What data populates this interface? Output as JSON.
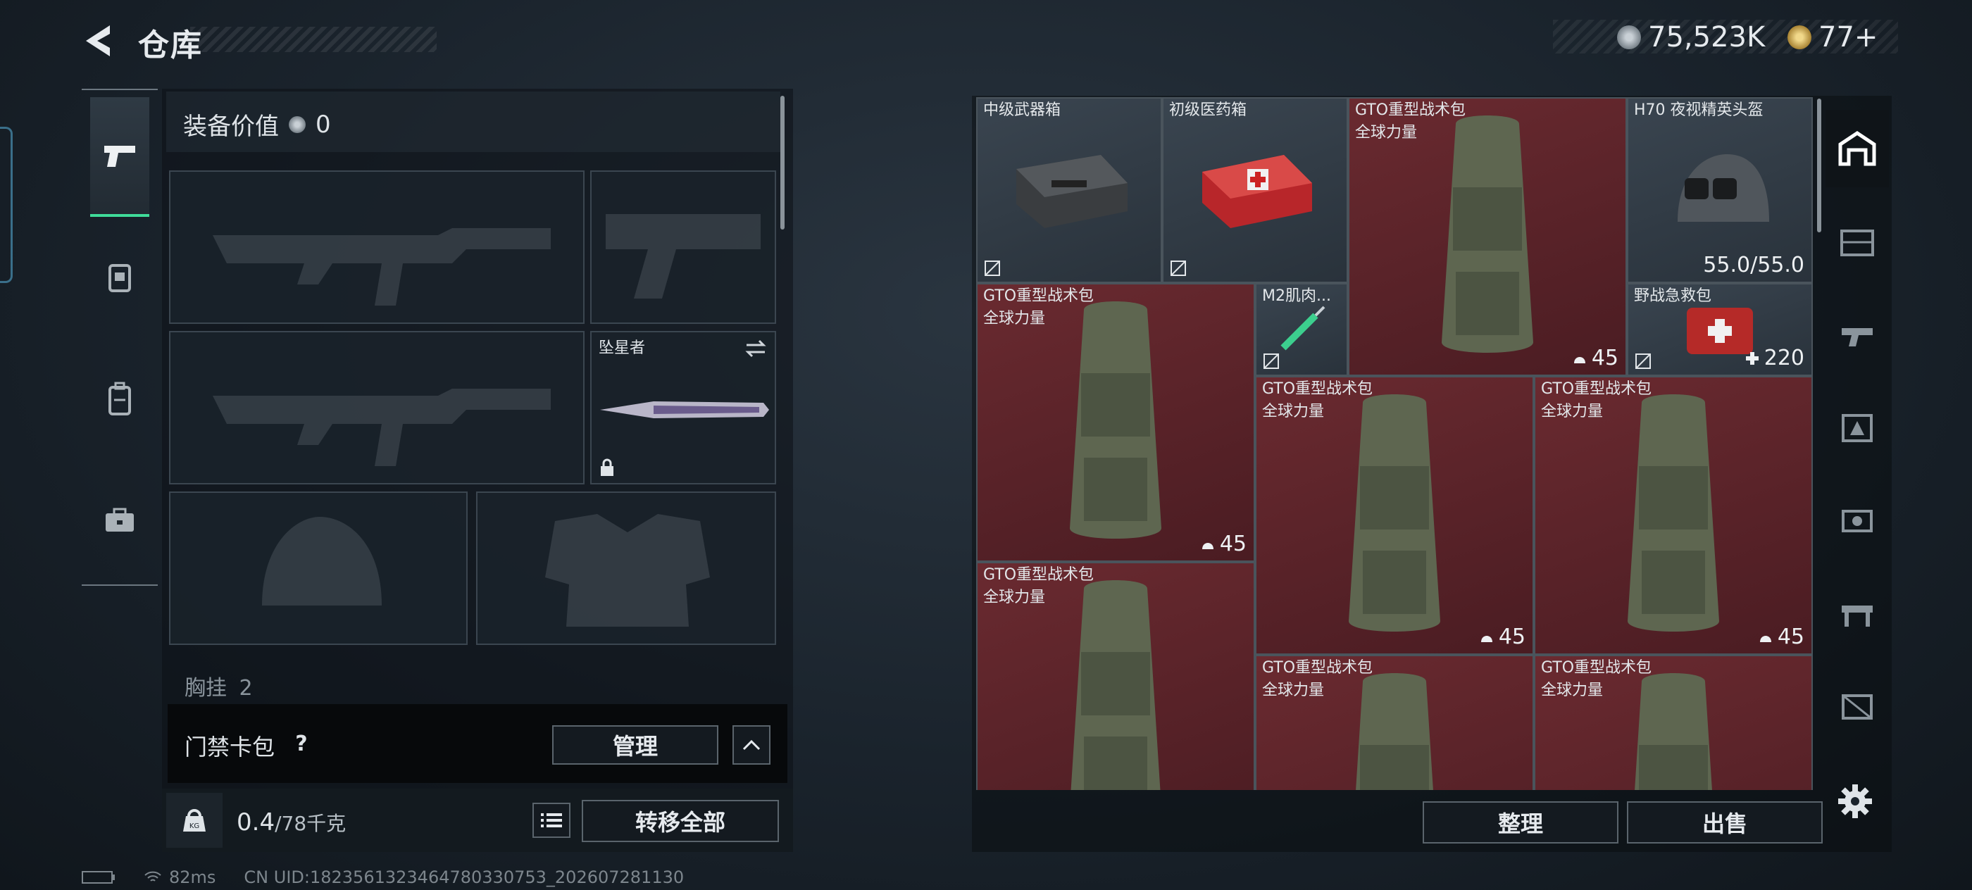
{
  "header": {
    "title": "仓库",
    "currency_1": "75,523K",
    "currency_2": "77+"
  },
  "equipment": {
    "value_label": "装备价值",
    "value": "0",
    "melee_name": "坠星者",
    "chest_label": "胸挂",
    "chest_value": "2",
    "keycard_label": "门禁卡包",
    "manage_label": "管理",
    "weight_current": "0.4",
    "weight_max": "/78千克",
    "transfer_all_label": "转移全部"
  },
  "status": {
    "ping": "82ms",
    "uid": "CN UID:1823561323464780330753_202607281130"
  },
  "storage": {
    "items": [
      {
        "name": "中级武器箱",
        "sub": "",
        "count": "",
        "color": "gray"
      },
      {
        "name": "初级医药箱",
        "sub": "",
        "count": "",
        "color": "gray"
      },
      {
        "name": "GTO重型战术包",
        "sub": "全球力量",
        "count": "45",
        "color": "red"
      },
      {
        "name": "H70 夜视精英头盔",
        "sub": "",
        "count": "55.0/55.0",
        "color": "gray"
      },
      {
        "name": "GTO重型战术包",
        "sub": "全球力量",
        "count": "45",
        "color": "red"
      },
      {
        "name": "M2肌肉...",
        "sub": "",
        "count": "",
        "color": "gray"
      },
      {
        "name": "野战急救包",
        "sub": "",
        "count": "220",
        "color": "gray"
      },
      {
        "name": "GTO重型战术包",
        "sub": "全球力量",
        "count": "45",
        "color": "red"
      },
      {
        "name": "GTO重型战术包",
        "sub": "全球力量",
        "count": "45",
        "color": "red"
      },
      {
        "name": "GTO重型战术包",
        "sub": "全球力量",
        "count": "",
        "color": "red"
      },
      {
        "name": "GTO重型战术包",
        "sub": "全球力量",
        "count": "",
        "color": "red"
      },
      {
        "name": "GTO重型战术包",
        "sub": "全球力量",
        "count": "",
        "color": "red"
      }
    ],
    "sort_label": "整理",
    "sell_label": "出售"
  },
  "colors": {
    "accent_green": "#3fdc9a",
    "item_red": "#5a2228",
    "item_gray": "#323c46"
  }
}
